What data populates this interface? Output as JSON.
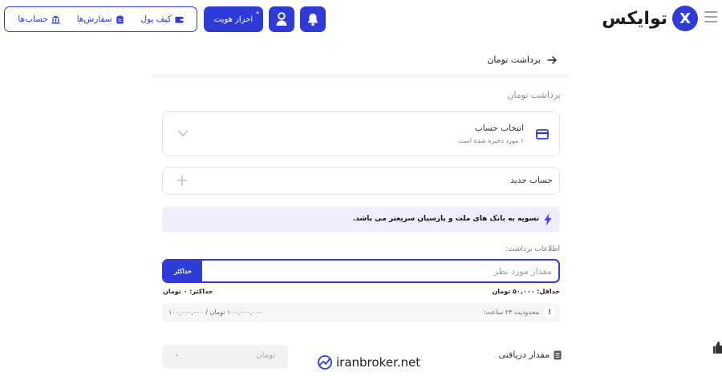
{
  "header": {
    "logo_text": "توایکس",
    "logo_mark": "X",
    "kyc_label": "احراز هویت",
    "kyc_dot": "*",
    "nav": [
      {
        "label": "کیف پول",
        "icon": "wallet-icon"
      },
      {
        "label": "سفارش‌ها",
        "icon": "clipboard-icon"
      },
      {
        "label": "حساب‌ها",
        "icon": "bank-icon"
      }
    ],
    "icons": {
      "menu": "hamburger-icon",
      "bell": "bell-icon",
      "user": "user-icon"
    }
  },
  "page": {
    "title": "برداشت تومان"
  },
  "form": {
    "section_label": "برداشت تومان",
    "account": {
      "title": "انتخاب حساب",
      "subtitle": "۱ مورد ذخیره شده است"
    },
    "new_account": "حساب جدید",
    "notice": "تسویه به بانک های ملت و پارسیان سریعتر می باشد.",
    "info_label": "اطلاعات برداشت:",
    "amount_placeholder": "مقدار مورد نظر",
    "max_button": "حداکثر",
    "min_text": "حداقل: ۵۰,۰۰۰ تومان",
    "max_text": "حداکثر: ۰ تومان",
    "limit_label": "محدودیت ۲۴ ساعت:",
    "limit_value": "۱۰۰,۰۰۰,۰۰۰ تومان / ۱۰۰,۰۰۰,۰۰۰",
    "limit_info": "!",
    "receive_label": "مقدار دریافتی",
    "receive_unit": "تومان",
    "receive_amount": "۰"
  },
  "watermark": "iranbroker.net",
  "colors": {
    "accent": "#2e3bd6",
    "notice_bg": "#eeedfb",
    "bolt": "#5b3fd9"
  }
}
